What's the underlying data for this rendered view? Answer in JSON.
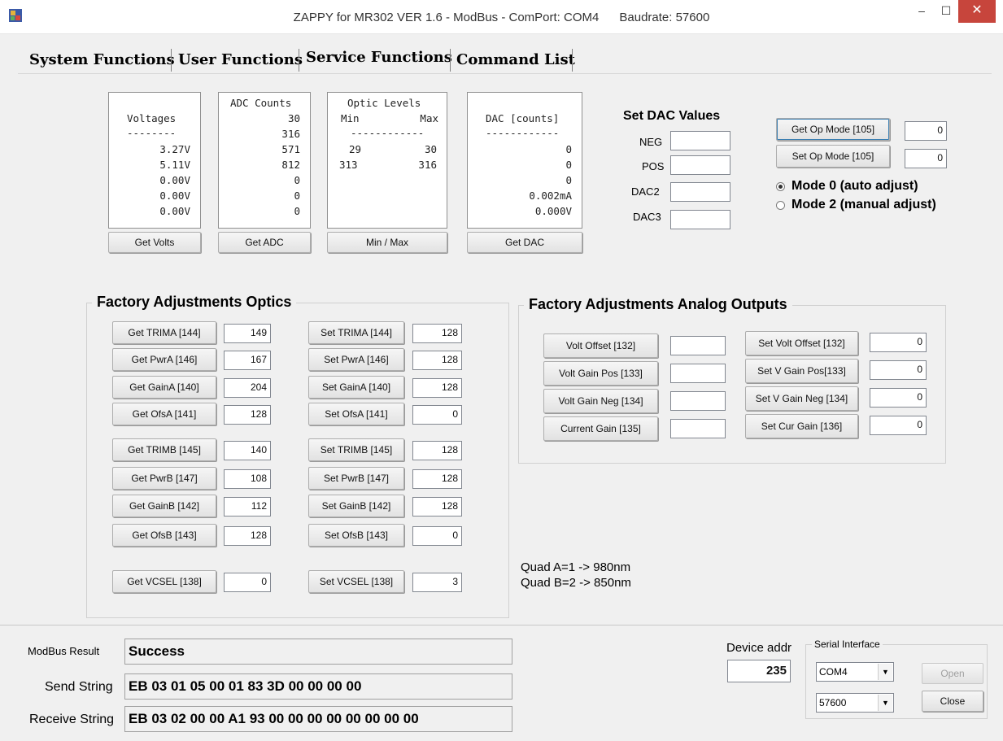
{
  "window": {
    "title": "ZAPPY for MR302 VER 1.6 - ModBus - ComPort: COM4",
    "baud_title": "Baudrate: 57600",
    "min_glyph": "–",
    "max_glyph": "☐",
    "close_glyph": "✕"
  },
  "tabs": [
    {
      "label": "System Functions"
    },
    {
      "label": "User Functions"
    },
    {
      "label": "Service Functions",
      "active": true
    },
    {
      "label": "Command List"
    }
  ],
  "readouts": {
    "voltages": {
      "lines": [
        "Voltages",
        "--------",
        "3.27V",
        "5.11V",
        "0.00V",
        "0.00V",
        "0.00V"
      ],
      "button": "Get Volts"
    },
    "adc": {
      "lines": [
        "ADC Counts",
        "30",
        "316",
        "571",
        "812",
        "0",
        "0",
        "0"
      ],
      "button": "Get ADC"
    },
    "optic": {
      "header": "Optic Levels",
      "min_label": "Min",
      "max_label": "Max",
      "sep": "------------",
      "row1_min": "29",
      "row1_max": "30",
      "row2_min": "313",
      "row2_max": "316",
      "button": "Min / Max"
    },
    "dac": {
      "lines": [
        "DAC [counts]",
        "------------",
        "0",
        "0",
        "0",
        "0.002mA",
        "0.000V"
      ],
      "button": "Get DAC"
    }
  },
  "set_dac": {
    "title": "Set DAC Values",
    "fields": [
      {
        "label": "NEG",
        "value": ""
      },
      {
        "label": "POS",
        "value": ""
      },
      {
        "label": "DAC2",
        "value": ""
      },
      {
        "label": "DAC3",
        "value": ""
      }
    ]
  },
  "op_mode": {
    "get_label": "Get Op Mode [105]",
    "get_value": "0",
    "set_label": "Set Op Mode [105]",
    "set_value": "0",
    "mode0": "Mode 0 (auto adjust)",
    "mode2": "Mode 2 (manual adjust)",
    "selected": "mode0"
  },
  "optics": {
    "title": "Factory Adjustments Optics",
    "rows": [
      {
        "get": "Get TRIMA [144]",
        "get_value": "149",
        "set": "Set TRIMA [144]",
        "set_value": "128"
      },
      {
        "get": "Get PwrA [146]",
        "get_value": "167",
        "set": "Set PwrA [146]",
        "set_value": "128"
      },
      {
        "get": "Get GainA [140]",
        "get_value": "204",
        "set": "Set GainA [140]",
        "set_value": "128"
      },
      {
        "get": "Get OfsA  [141]",
        "get_value": "128",
        "set": "Set OfsA [141]",
        "set_value": "0"
      },
      {
        "get": "Get TRIMB  [145]",
        "get_value": "140",
        "set": "Set TRIMB [145]",
        "set_value": "128"
      },
      {
        "get": "Get PwrB [147]",
        "get_value": "108",
        "set": "Set PwrB [147]",
        "set_value": "128"
      },
      {
        "get": "Get GainB [142]",
        "get_value": "112",
        "set": "Set GainB [142]",
        "set_value": "128"
      },
      {
        "get": "Get OfsB  [143]",
        "get_value": "128",
        "set": "Set OfsB [143]",
        "set_value": "0"
      },
      {
        "get": "Get VCSEL [138]",
        "get_value": "0",
        "set": "Set VCSEL [138]",
        "set_value": "3"
      }
    ]
  },
  "analog": {
    "title": "Factory Adjustments Analog Outputs",
    "rows": [
      {
        "get": "Volt Offset  [132]",
        "get_value": "",
        "set": "Set Volt Offset [132]",
        "set_value": "0"
      },
      {
        "get": "Volt Gain Pos  [133]",
        "get_value": "",
        "set": "Set V Gain Pos[133]",
        "set_value": "0"
      },
      {
        "get": "Volt Gain Neg  [134]",
        "get_value": "",
        "set": "Set V Gain Neg [134]",
        "set_value": "0"
      },
      {
        "get": "Current Gain  [135]",
        "get_value": "",
        "set": "Set Cur Gain [136]",
        "set_value": "0"
      }
    ]
  },
  "quad_notes": [
    "Quad A=1 -> 980nm",
    "Quad B=2 -> 850nm"
  ],
  "status": {
    "result_label": "ModBus Result",
    "result_value": "Success",
    "send_label": "Send String",
    "send_value": "EB 03 01 05 00 01 83 3D 00 00 00 00",
    "receive_label": "Receive String",
    "receive_value": "EB 03 02 00 00 A1 93 00 00 00 00 00 00 00 00"
  },
  "device": {
    "label": "Device addr",
    "value": "235"
  },
  "serial": {
    "title": "Serial Interface",
    "port": "COM4",
    "baud": "57600",
    "open_label": "Open",
    "close_label": "Close"
  }
}
